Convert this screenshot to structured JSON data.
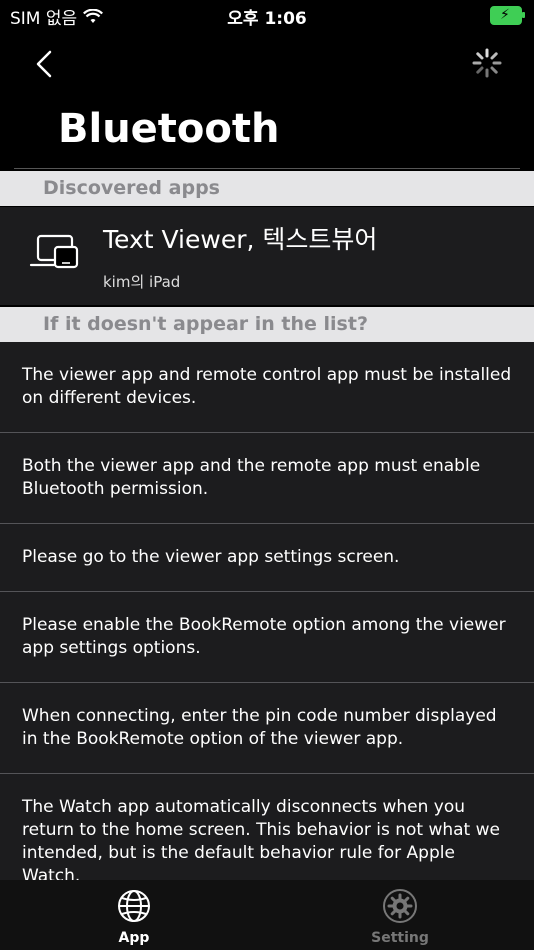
{
  "status": {
    "carrier": "SIM 없음",
    "time": "오후 1:06"
  },
  "header": {
    "title": "Bluetooth"
  },
  "sections": {
    "discovered": "Discovered apps",
    "help": "If it doesn't appear in the list?"
  },
  "device": {
    "name": "Text Viewer, 텍스트뷰어",
    "owner": "kim의 iPad"
  },
  "help_items": [
    "The viewer app and remote control app must be installed on different devices.",
    "Both the viewer app and the remote app must enable Bluetooth permission.",
    "Please go to the viewer app settings screen.",
    "Please enable the BookRemote option among the viewer app settings options.",
    "When connecting, enter the pin code number displayed in the BookRemote option of the viewer app.",
    "The Watch app automatically disconnects when you return to the home screen. This behavior is not what we intended, but is the default behavior rule for Apple Watch."
  ],
  "tabs": {
    "app": "App",
    "setting": "Setting"
  },
  "icons": {
    "back": "chevron-left-icon",
    "spinner": "activity-spinner-icon",
    "device": "devices-icon",
    "app_tab": "globe-icon",
    "setting_tab": "gear-icon"
  },
  "colors": {
    "battery": "#3fce55",
    "section_bg": "#e5e5e7",
    "row_bg": "#1c1c1e"
  }
}
